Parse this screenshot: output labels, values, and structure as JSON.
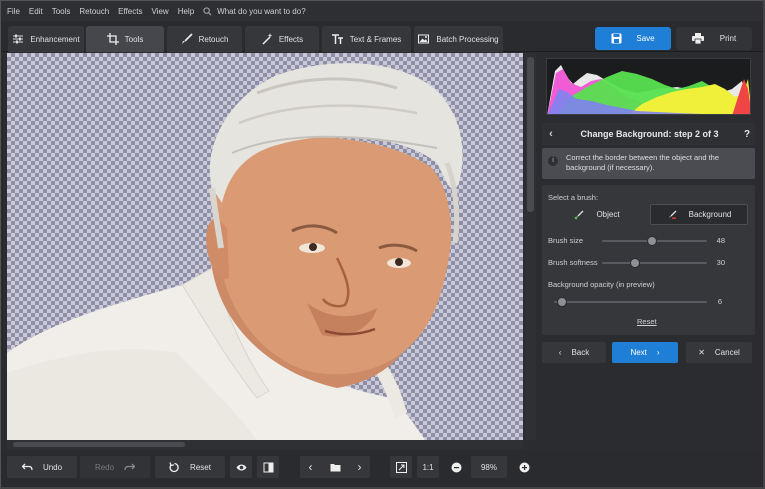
{
  "menu": [
    "File",
    "Edit",
    "Tools",
    "Retouch",
    "Effects",
    "View",
    "Help"
  ],
  "search_placeholder": "What do you want to do?",
  "tabs": [
    {
      "label": "Enhancement",
      "icon": "sliders-icon"
    },
    {
      "label": "Tools",
      "icon": "crop-icon"
    },
    {
      "label": "Retouch",
      "icon": "brush-icon"
    },
    {
      "label": "Effects",
      "icon": "magic-wand-icon"
    },
    {
      "label": "Text & Frames",
      "icon": "text-icon"
    },
    {
      "label": "Batch Processing",
      "icon": "images-icon"
    }
  ],
  "active_tab": "Tools",
  "save_label": "Save",
  "print_label": "Print",
  "panel": {
    "step_title": "Change Background: step 2 of 3",
    "help": "?",
    "info_text": "Correct the border between the object and the background (if necessary).",
    "select_brush_label": "Select a brush:",
    "brush_object": "Object",
    "brush_background": "Background",
    "active_brush": "Background",
    "brush_size_label": "Brush size",
    "brush_size_value": "48",
    "brush_softness_label": "Brush softness",
    "brush_softness_value": "30",
    "bg_opacity_label": "Background opacity (in preview)",
    "bg_opacity_value": "6",
    "reset_label": "Reset",
    "back_label": "Back",
    "next_label": "Next",
    "cancel_label": "Cancel"
  },
  "bottom": {
    "undo_label": "Undo",
    "redo_label": "Redo",
    "reset_label": "Reset",
    "one_to_one": "1:1",
    "zoom": "98%"
  },
  "colors": {
    "accent": "#1f7fd6",
    "background": "#2b2c2f"
  }
}
